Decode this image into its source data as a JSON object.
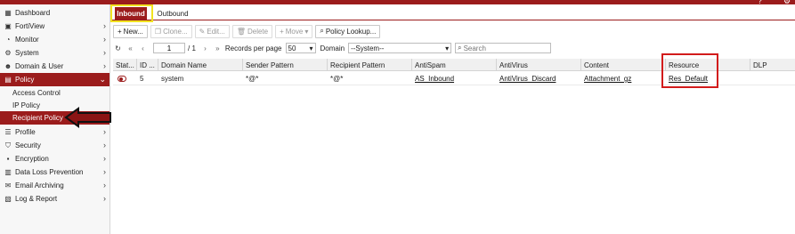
{
  "sidebar": {
    "items": [
      {
        "label": "Dashboard",
        "icon": "dashboard-icon"
      },
      {
        "label": "FortiView",
        "icon": "fortiview-icon"
      },
      {
        "label": "Monitor",
        "icon": "monitor-icon"
      },
      {
        "label": "System",
        "icon": "system-gear-icon"
      },
      {
        "label": "Domain & User",
        "icon": "domain-user-icon"
      },
      {
        "label": "Policy",
        "icon": "policy-icon"
      },
      {
        "label": "Profile",
        "icon": "profile-icon"
      },
      {
        "label": "Security",
        "icon": "security-shield-icon"
      },
      {
        "label": "Encryption",
        "icon": "lock-icon"
      },
      {
        "label": "Data Loss Prevention",
        "icon": "dlp-icon"
      },
      {
        "label": "Email Archiving",
        "icon": "email-icon"
      },
      {
        "label": "Log & Report",
        "icon": "log-report-icon"
      }
    ],
    "policy_subitems": [
      "Access Control",
      "IP Policy",
      "Recipient Policy"
    ]
  },
  "tabs": {
    "inbound": "Inbound",
    "outbound": "Outbound"
  },
  "toolbar": {
    "new": "New...",
    "clone": "Clone...",
    "edit": "Edit...",
    "delete": "Delete",
    "move": "Move",
    "policy_lookup": "Policy Lookup..."
  },
  "pager": {
    "page": "1",
    "total": "/ 1",
    "records_label": "Records per page",
    "records_value": "50",
    "domain_label": "Domain",
    "domain_value": "--System--",
    "search_placeholder": "Search"
  },
  "table": {
    "headers": [
      "Stat...",
      "ID ...",
      "Domain Name",
      "Sender Pattern",
      "Recipient Pattern",
      "AntiSpam",
      "AntiVirus",
      "Content",
      "Resource",
      "DLP"
    ],
    "rows": [
      {
        "id": "5",
        "domain": "system",
        "sender": "*@*",
        "recipient": "*@*",
        "antispam": "AS_Inbound",
        "antivirus": "AntiVirus_Discard",
        "content": "Attachment_gz",
        "resource": "Res_Default",
        "dlp": ""
      }
    ]
  },
  "colors": {
    "brand": "#9b1c1c",
    "highlight_yellow": "#f2e320",
    "highlight_red": "#d21b1b"
  }
}
